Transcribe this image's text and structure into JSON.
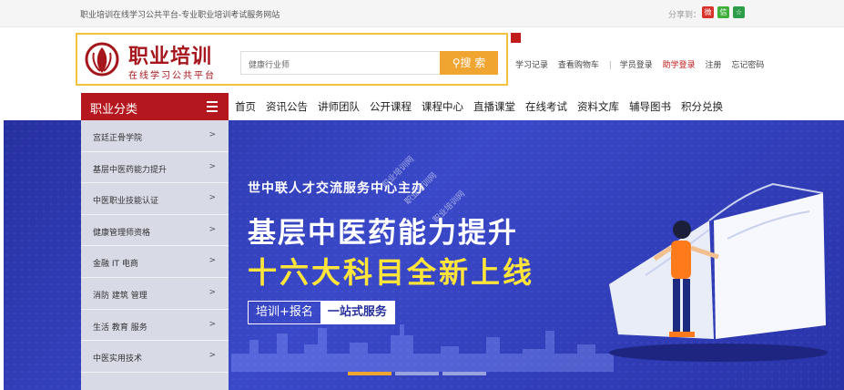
{
  "topbar": {
    "tagline": "职业培训在线学习公共平台-专业职业培训考试服务网站",
    "share_label": "分享到："
  },
  "header": {
    "logo_title": "职业培训",
    "logo_subtitle": "在线学习公共平台",
    "search_placeholder": "健康行业师",
    "search_button": "搜 索",
    "user_links": [
      "学习记录",
      "查看购物车"
    ],
    "login": "学员登录",
    "helper_login": "助学登录",
    "register": "注册",
    "forgot": "忘记密码"
  },
  "nav": {
    "category_label": "职业分类",
    "items": [
      "首页",
      "资讯公告",
      "讲师团队",
      "公开课程",
      "课程中心",
      "直播课堂",
      "在线考试",
      "资料文库",
      "辅导图书",
      "积分兑换"
    ]
  },
  "sidebar": {
    "items": [
      {
        "label": "宫廷正骨学院",
        "arrow": ">"
      },
      {
        "label": "基层中医药能力提升",
        "arrow": ">"
      },
      {
        "label": "中医职业技能认证",
        "arrow": ">"
      },
      {
        "label": "健康管理师资格",
        "arrow": ">"
      },
      {
        "label": "金融 IT 电商",
        "arrow": ">"
      },
      {
        "label": "消防 建筑 管理",
        "arrow": ">"
      },
      {
        "label": "生活 教育 服务",
        "arrow": ">"
      },
      {
        "label": "中医实用技术",
        "arrow": ">"
      }
    ]
  },
  "banner": {
    "organizer": "世中联人才交流服务中心主办",
    "title": "基层中医药能力提升",
    "title2": "十六大科目全新上线",
    "tag_left": "培训+报名",
    "tag_right": "一站式服务",
    "watermarks": [
      "职业培训网",
      "职业培训网",
      "职业培训网"
    ]
  },
  "colors": {
    "brand_red": "#b5171f",
    "accent_orange": "#f0a531",
    "logo_border": "#f2c23e",
    "banner_blue": "#2e3ab5",
    "highlight_yellow": "#ffe53a"
  }
}
